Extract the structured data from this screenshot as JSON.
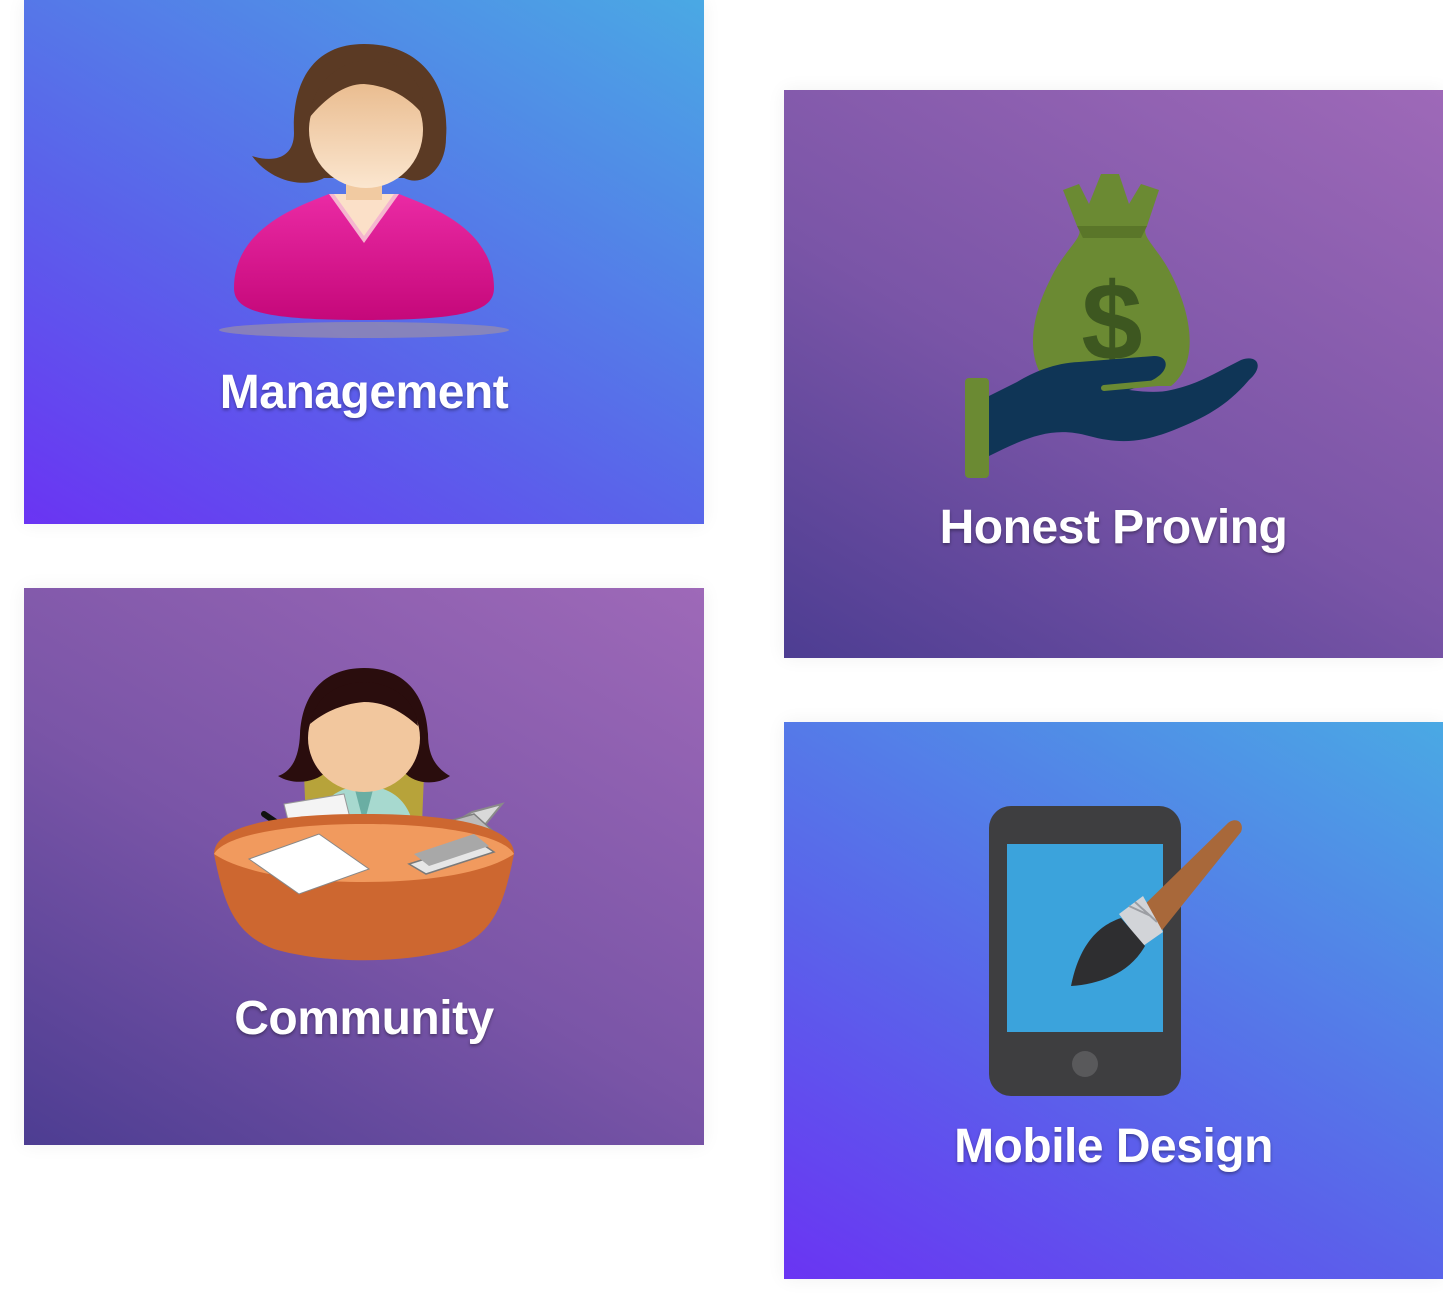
{
  "cards": [
    {
      "label": "Management",
      "icon": "woman-avatar-icon",
      "style": "blue"
    },
    {
      "label": "Honest Proving",
      "icon": "money-bag-hand-icon",
      "style": "purple"
    },
    {
      "label": "Community",
      "icon": "woman-at-desk-icon",
      "style": "purple"
    },
    {
      "label": "Mobile Design",
      "icon": "phone-paintbrush-icon",
      "style": "blue"
    }
  ],
  "colors": {
    "blue_gradient": [
      "#6a34f3",
      "#5a63ea",
      "#4aa9e4"
    ],
    "purple_gradient": [
      "#4d3d92",
      "#7a55a7",
      "#9e69b8"
    ],
    "label": "#ffffff"
  }
}
